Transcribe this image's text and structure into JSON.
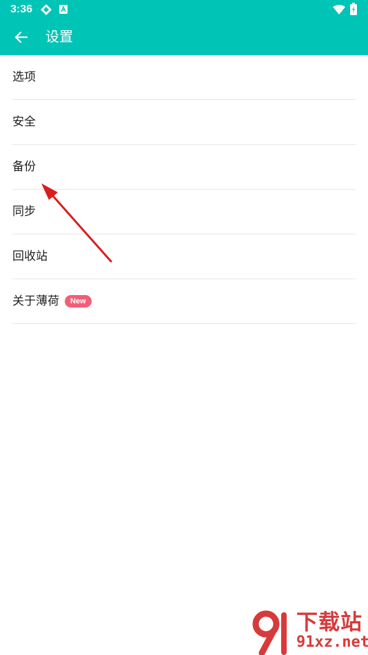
{
  "status_bar": {
    "time": "3:36"
  },
  "app_bar": {
    "title": "设置"
  },
  "settings": {
    "items": [
      {
        "label": "选项"
      },
      {
        "label": "安全"
      },
      {
        "label": "备份"
      },
      {
        "label": "同步"
      },
      {
        "label": "回收站"
      },
      {
        "label": "关于薄荷",
        "badge": "New"
      }
    ]
  },
  "watermark": {
    "title": "下载站",
    "url": "91xz.net"
  },
  "colors": {
    "app_bar": "#00c4b6",
    "badge": "#f35d78",
    "annotation_arrow": "#d91e1e",
    "watermark": "#d73a3a"
  }
}
